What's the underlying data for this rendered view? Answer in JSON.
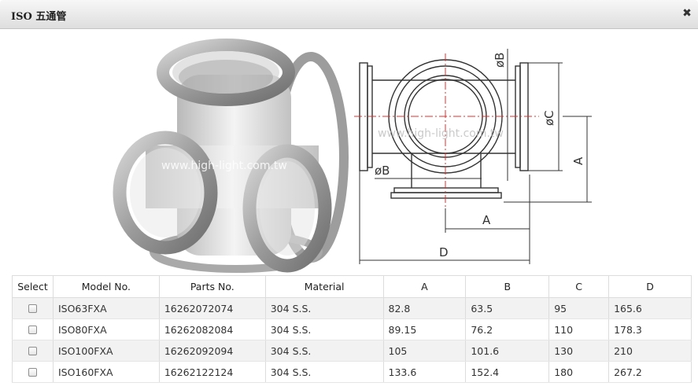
{
  "window": {
    "title": "ISO 五通管",
    "close_icon": "close-icon"
  },
  "figure": {
    "watermark": "www.high-light.com.tw",
    "dim_labels": {
      "dia_b_top": "øB",
      "dia_b_left": "øB",
      "dia_c": "øC",
      "a_vertical": "A",
      "a_horizontal": "A",
      "d": "D"
    }
  },
  "table": {
    "headers": [
      "Select",
      "Model No.",
      "Parts No.",
      "Material",
      "A",
      "B",
      "C",
      "D"
    ],
    "rows": [
      [
        "ISO63FXA",
        "16262072074",
        "304 S.S.",
        "82.8",
        "63.5",
        "95",
        "165.6"
      ],
      [
        "ISO80FXA",
        "16262082084",
        "304 S.S.",
        "89.15",
        "76.2",
        "110",
        "178.3"
      ],
      [
        "ISO100FXA",
        "16262092094",
        "304 S.S.",
        "105",
        "101.6",
        "130",
        "210"
      ],
      [
        "ISO160FXA",
        "16262122124",
        "304 S.S.",
        "133.6",
        "152.4",
        "180",
        "267.2"
      ]
    ]
  },
  "colors": {
    "titlebar": "#e6e6e6",
    "row_stripe": "#f2f2f2",
    "drawing_red": "#e03030"
  }
}
